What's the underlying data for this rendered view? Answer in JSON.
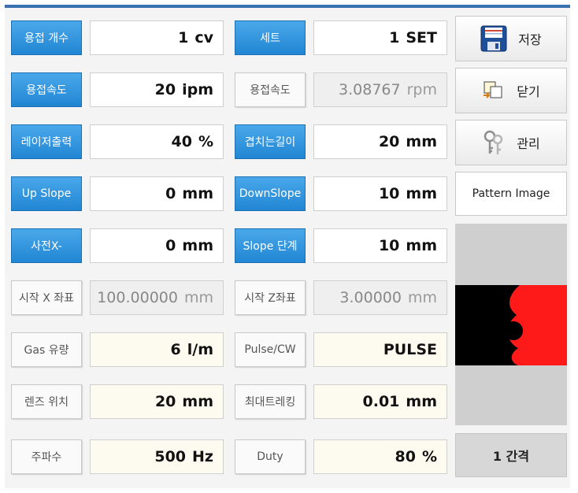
{
  "rows": [
    {
      "left": {
        "label": "용접 개수",
        "style": "blue",
        "value": "1",
        "unit": "cv",
        "box": "white"
      },
      "right": {
        "label": "세트",
        "style": "blue",
        "value": "1",
        "unit": "SET",
        "box": "white"
      }
    },
    {
      "left": {
        "label": "용접속도",
        "style": "blue",
        "value": "20",
        "unit": "ipm",
        "box": "white"
      },
      "right": {
        "label": "용접속도",
        "style": "gray",
        "value": "3.08767",
        "unit": "rpm",
        "box": "dis"
      }
    },
    {
      "left": {
        "label": "레이저출력",
        "style": "blue",
        "value": "40",
        "unit": "%",
        "box": "white"
      },
      "right": {
        "label": "겹치는길이",
        "style": "blue",
        "value": "20",
        "unit": "mm",
        "box": "white"
      }
    },
    {
      "left": {
        "label": "Up Slope",
        "style": "blue",
        "value": "0",
        "unit": "mm",
        "box": "white"
      },
      "right": {
        "label": "DownSlope",
        "style": "blue",
        "value": "10",
        "unit": "mm",
        "box": "white"
      }
    },
    {
      "left": {
        "label": "사전X-",
        "style": "blue",
        "value": "0",
        "unit": "mm",
        "box": "white"
      },
      "right": {
        "label": "Slope 단계",
        "style": "blue",
        "value": "10",
        "unit": "mm",
        "box": "white"
      }
    },
    {
      "left": {
        "label": "시작 X 좌표",
        "style": "gray",
        "value": "100.00000",
        "unit": "mm",
        "box": "dis"
      },
      "right": {
        "label": "시작 Z좌표",
        "style": "gray",
        "value": "3.00000",
        "unit": "mm",
        "box": "dis"
      }
    },
    {
      "left": {
        "label": "Gas 유량",
        "style": "gray",
        "value": "6",
        "unit": "l/m",
        "box": "cream"
      },
      "right": {
        "label": "Pulse/CW",
        "style": "gray",
        "value": "PULSE",
        "unit": "",
        "box": "cream"
      }
    },
    {
      "left": {
        "label": "렌즈 위치",
        "style": "gray",
        "value": "20",
        "unit": "mm",
        "box": "cream"
      },
      "right": {
        "label": "최대트레킹",
        "style": "gray",
        "value": "0.01",
        "unit": "mm",
        "box": "cream"
      }
    },
    {
      "left": {
        "label": "주파수",
        "style": "gray",
        "value": "500",
        "unit": "Hz",
        "box": "cream"
      },
      "right": {
        "label": "Duty",
        "style": "gray",
        "value": "80",
        "unit": "%",
        "box": "cream"
      }
    }
  ],
  "actions": {
    "save_label": "저장",
    "close_label": "닫기",
    "manage_label": "관리",
    "save_icon": "floppy-disk-icon",
    "close_icon": "close-window-icon",
    "manage_icon": "keys-icon"
  },
  "pattern_image_label": "Pattern Image",
  "interval_label": "1 간격",
  "colors": {
    "accent_blue": "#2186d3",
    "header_bar": "#3a6fb0",
    "pattern_red": "#ff1a1a",
    "pattern_black": "#000000"
  }
}
